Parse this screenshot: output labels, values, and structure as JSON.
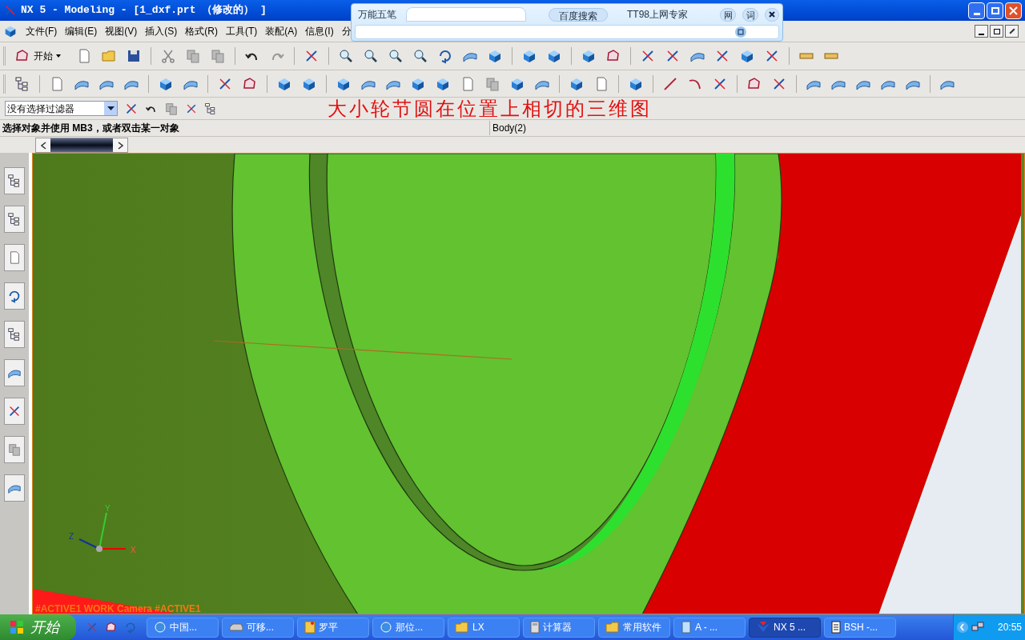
{
  "window": {
    "title": "NX 5 - Modeling - [1_dxf.prt （修改的） ]"
  },
  "ime_bar": {
    "name": "万能五笔",
    "search_button": "百度搜索",
    "expert_button": "TT98上网专家",
    "web_button": "网",
    "word_button": "词"
  },
  "menu": [
    "文件(F)",
    "编辑(E)",
    "视图(V)",
    "插入(S)",
    "格式(R)",
    "工具(T)",
    "装配(A)",
    "信息(I)",
    "分"
  ],
  "start_tool": "开始",
  "selection_filter": {
    "value": "没有选择过滤器"
  },
  "caption": "大小轮节圆在位置上相切的三维图",
  "cue_line": "选择对象并使用 MB3，或者双击某一对象",
  "status": "Body(2)",
  "viewport": {
    "axes": {
      "x": "X",
      "y": "Y",
      "z": "Z"
    },
    "view_label": "#ACTIVE1 WORK Camera #ACTIVE1"
  },
  "taskbar": {
    "start": "开始",
    "tasks": [
      {
        "label": "中国...",
        "kind": "browser",
        "selected": false
      },
      {
        "label": "可移...",
        "kind": "drive",
        "selected": false
      },
      {
        "label": "罗平",
        "kind": "note",
        "selected": false
      },
      {
        "label": "那位...",
        "kind": "browser",
        "selected": false
      },
      {
        "label": "LX",
        "kind": "folder",
        "selected": false
      },
      {
        "label": "计算器",
        "kind": "calculator",
        "selected": false
      },
      {
        "label": "常用软件",
        "kind": "folder",
        "selected": false
      },
      {
        "label": "A - ...",
        "kind": "document",
        "selected": false
      },
      {
        "label": "NX 5 ...",
        "kind": "nx",
        "selected": true
      },
      {
        "label": "BSH -...",
        "kind": "notepad",
        "selected": false
      }
    ],
    "clock": "20:55"
  }
}
